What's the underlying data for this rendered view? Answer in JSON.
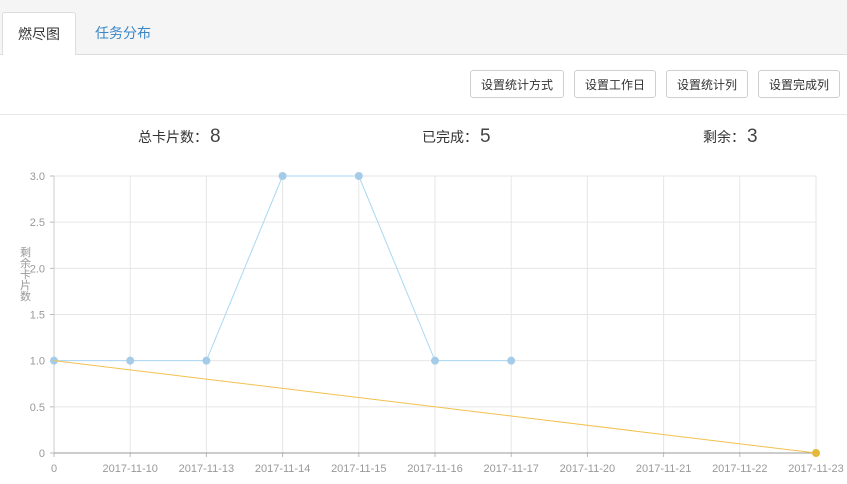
{
  "tabs": [
    {
      "label": "燃尽图",
      "active": true
    },
    {
      "label": "任务分布",
      "active": false
    }
  ],
  "toolbar": {
    "buttons": [
      "设置统计方式",
      "设置工作日",
      "设置统计列",
      "设置完成列"
    ]
  },
  "stats": {
    "total_label": "总卡片数：",
    "total_value": "8",
    "done_label": "已完成：",
    "done_value": "5",
    "remaining_label": "剩余：",
    "remaining_value": "3"
  },
  "colors": {
    "actual": "#a9d8f3",
    "actual_point": "#a4cce8",
    "ideal": "#f2c14e",
    "ideal_point": "#e6b83a",
    "grid": "#e6e6e6",
    "axis_text": "#999999",
    "tab_link": "#3a87c8"
  },
  "chart_data": {
    "type": "line",
    "ylabel": "剩余卡片数",
    "categories": [
      "0",
      "2017-11-10",
      "2017-11-13",
      "2017-11-14",
      "2017-11-15",
      "2017-11-16",
      "2017-11-17",
      "2017-11-20",
      "2017-11-21",
      "2017-11-22",
      "2017-11-23"
    ],
    "yticks": [
      "0",
      "0.5",
      "1.0",
      "1.5",
      "2.0",
      "2.5",
      "3.0"
    ],
    "ylim": [
      0,
      3
    ],
    "grid": true,
    "series": [
      {
        "key": "actual",
        "values": [
          1,
          1,
          1,
          3,
          3,
          1,
          1,
          null,
          null,
          null,
          null
        ]
      },
      {
        "key": "ideal",
        "values": [
          1,
          null,
          null,
          null,
          null,
          null,
          null,
          null,
          null,
          null,
          0
        ]
      }
    ]
  }
}
